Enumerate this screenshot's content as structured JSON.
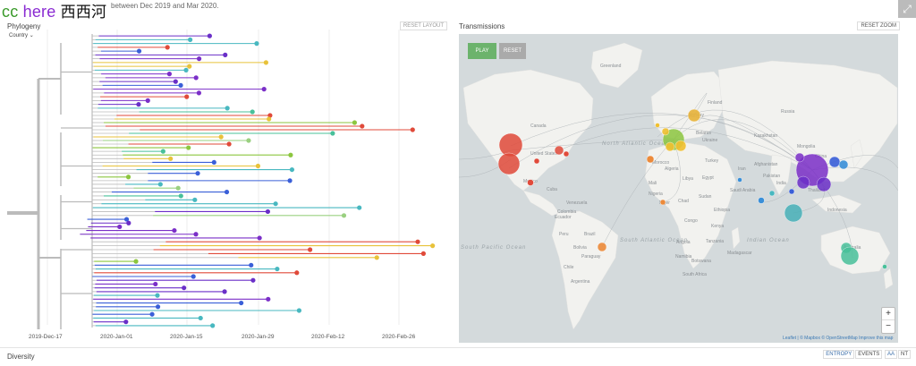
{
  "logo": {
    "part1": "cc",
    "part2": "here",
    "part3": "西西河"
  },
  "header": {
    "subtitle": "between Dec 2019 and Mar 2020.",
    "expand_icon": "expand-icon"
  },
  "phylogeny": {
    "title": "Phylogeny",
    "filter_label": "Country",
    "reset_layout": "RESET LAYOUT",
    "axis_ticks": [
      "2019-Dec-17",
      "2020-Jan-01",
      "2020-Jan-15",
      "2020-Jan-29",
      "2020-Feb-12",
      "2020-Feb-26"
    ]
  },
  "transmissions": {
    "title": "Transmissions",
    "reset_zoom": "RESET ZOOM",
    "play": "PLAY",
    "reset": "RESET",
    "zoom_in": "+",
    "zoom_out": "−",
    "attribution": "Leaflet | © Mapbox © OpenStreetMap Improve this map",
    "labels": [
      "Greenland",
      "Canada",
      "Russia",
      "Mongolia",
      "Norway",
      "Finland",
      "Belarus",
      "Ukraine",
      "Turkey",
      "Iran",
      "Libya",
      "Egypt",
      "Saudi Arabia",
      "Niger",
      "Chad",
      "Sudan",
      "Ethiopia",
      "Kenya",
      "Nigeria",
      "Congo",
      "Tanzania",
      "Angola",
      "Namibia",
      "South Africa",
      "Botswana",
      "Madagascar",
      "Kazakhstan",
      "Afghanistan",
      "Pakistan",
      "India",
      "China",
      "Thailand",
      "Indonesia",
      "Australia",
      "United States",
      "Mexico",
      "Cuba",
      "Venezuela",
      "Colombia",
      "Peru",
      "Brazil",
      "Bolivia",
      "Chile",
      "Argentina",
      "Paraguay",
      "Ecuador",
      "Mali",
      "Morocco",
      "Algeria"
    ],
    "oceans": [
      "North Atlantic Ocean",
      "South Atlantic Ocean",
      "South Pacific Ocean",
      "Indian Ocean"
    ]
  },
  "footer": {
    "diversity": "Diversity",
    "entropy": "ENTROPY",
    "events": "EVENTS",
    "aa": "AA",
    "nt": "NT"
  }
}
